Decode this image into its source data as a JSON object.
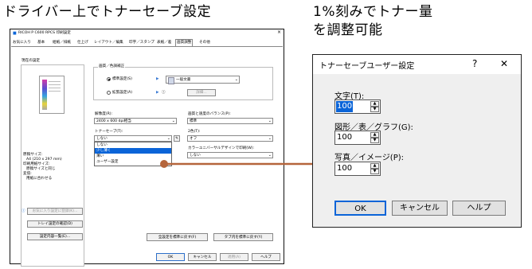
{
  "captions": {
    "left": "ドライバー上でトナーセーブ設定",
    "right_line1": "1%刻みでトナー量",
    "right_line2": "を調整可能"
  },
  "printer_dialog": {
    "title": "RICOH P C600 RPCS 印刷設定",
    "tabs": [
      "お気に入り",
      "基本",
      "給紙／排紙",
      "仕上げ",
      "レイアウト／編集",
      "印字／スタンプ",
      "表紙／差",
      "画質調整",
      "その他"
    ],
    "current_settings_label": "現在の設定",
    "image_correction_label": "画質／色調補正",
    "radio_standard": "標準設定(S)",
    "radio_extended": "拡張設定(A)",
    "preset_value": "一般文書",
    "detail_button": "詳細...",
    "resolution_label": "解像度(R):",
    "resolution_value": "2400 x 600 dpi相当",
    "balance_label": "画質と速度のバランス(P):",
    "balance_value": "標準",
    "toner_save_label": "トナーセーブ(T):",
    "toner_save_value": "しない",
    "toner_options": [
      "しない",
      "少し薄く",
      "薄い",
      "ユーザー設定"
    ],
    "dither_label": "2色(T):",
    "dither_value": "オフ",
    "universal_label": "カラーユニバーサルデザインで印刷(W):",
    "universal_value": "しない",
    "original_size_label": "原稿サイズ:",
    "original_size_value": "A4 (210 x 297 mm)",
    "print_paper_label": "印刷用紙サイズ:",
    "print_paper_value": "原稿サイズと同じ",
    "zoom_label": "変倍:",
    "zoom_value": "用紙に合わせる",
    "register_button": "お気に入り設定に登録(K)...",
    "tray_button": "トレイ設定の確認(D)",
    "list_button": "設定内容一覧(E)...",
    "reset_all_button": "全設定を標準に戻す(F)",
    "reset_tab_button": "タブ内を標準に戻す(Y)",
    "ok": "OK",
    "cancel": "キャンセル",
    "apply": "適用(A)",
    "help": "ヘルプ"
  },
  "toner_dialog": {
    "title": "トナーセーブユーザー設定",
    "help_glyph": "?",
    "close_glyph": "✕",
    "text_label": "文字(T):",
    "text_value": "100",
    "graphic_label": "図形／表／グラフ(G):",
    "graphic_value": "100",
    "photo_label": "写真／イメージ(P):",
    "photo_value": "100",
    "ok": "OK",
    "cancel": "キャンセル",
    "help": "ヘルプ"
  },
  "colors": {
    "accent_line": "#b5653b",
    "selection": "#0a64d8"
  }
}
